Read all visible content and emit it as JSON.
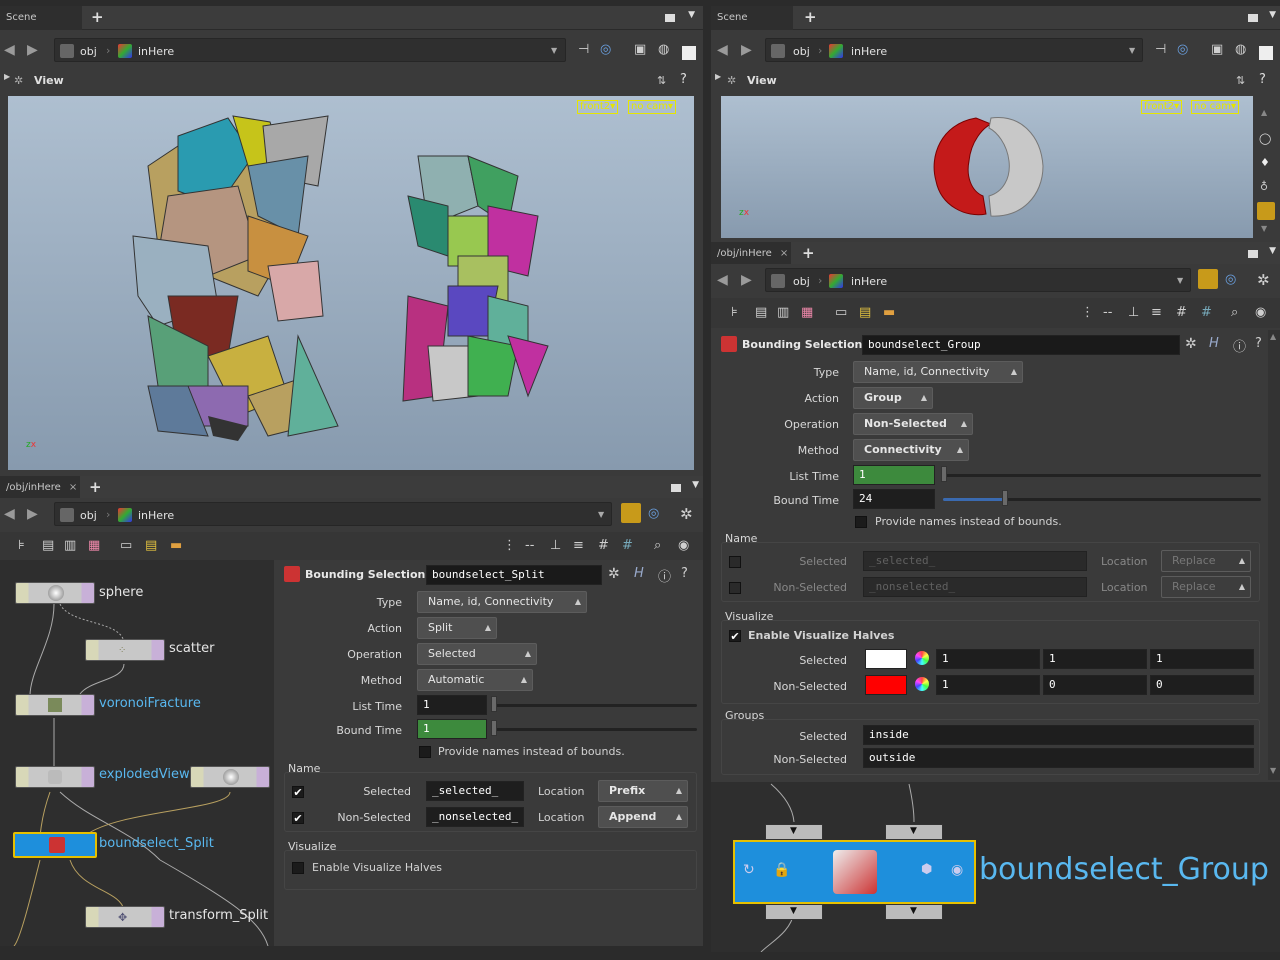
{
  "left_scene": {
    "tab": "Scene View",
    "path_obj": "obj",
    "path_node": "inHere",
    "view_label": "View",
    "cam_view": "front2",
    "cam_cam": "no cam"
  },
  "right_scene": {
    "tab": "Scene View",
    "path_obj": "obj",
    "path_node": "inHere",
    "view_label": "View",
    "cam_view": "front2",
    "cam_cam": "no cam"
  },
  "left_network": {
    "tab": "/obj/inHere",
    "path_obj": "obj",
    "path_node": "inHere",
    "nodes": [
      {
        "label": "sphere"
      },
      {
        "label": "scatter"
      },
      {
        "label": "voronoiFracture"
      },
      {
        "label": "explodedView"
      },
      {
        "label": "boundselect_Split"
      },
      {
        "label": "transform_Split"
      }
    ],
    "parms": {
      "title": "Bounding Selection",
      "node_name": "boundselect_Split",
      "type_label": "Type",
      "type_value": "Name, id, Connectivity",
      "action_label": "Action",
      "action_value": "Split",
      "operation_label": "Operation",
      "operation_value": "Selected",
      "method_label": "Method",
      "method_value": "Automatic",
      "list_time_label": "List Time",
      "list_time_value": "1",
      "bound_time_label": "Bound Time",
      "bound_time_value": "1",
      "provide_names": "Provide names instead of bounds.",
      "name_section": "Name",
      "selected_label": "Selected",
      "selected_value": "_selected_",
      "location_label": "Location",
      "selected_location": "Prefix",
      "nonselected_label": "Non-Selected",
      "nonselected_value": "_nonselected_",
      "nonselected_location": "Append",
      "visualize_section": "Visualize",
      "enable_visualize": "Enable Visualize Halves"
    }
  },
  "right_network": {
    "tab": "/obj/inHere",
    "path_obj": "obj",
    "path_node": "inHere",
    "node_label": "boundselect_Group",
    "parms": {
      "title": "Bounding Selection",
      "node_name": "boundselect_Group",
      "type_label": "Type",
      "type_value": "Name, id, Connectivity",
      "action_label": "Action",
      "action_value": "Group",
      "operation_label": "Operation",
      "operation_value": "Non-Selected",
      "method_label": "Method",
      "method_value": "Connectivity",
      "list_time_label": "List Time",
      "list_time_value": "1",
      "bound_time_label": "Bound Time",
      "bound_time_value": "24",
      "provide_names": "Provide names instead of bounds.",
      "name_section": "Name",
      "selected_label": "Selected",
      "selected_value": "_selected_",
      "location_label": "Location",
      "selected_location": "Replace",
      "nonselected_label": "Non-Selected",
      "nonselected_value": "_nonselected_",
      "nonselected_location": "Replace",
      "visualize_section": "Visualize",
      "enable_visualize": "Enable Visualize Halves",
      "vis_selected_label": "Selected",
      "vis_selected_color": "#ffffff",
      "vis_selected_rgb": [
        "1",
        "1",
        "1"
      ],
      "vis_nonselected_label": "Non-Selected",
      "vis_nonselected_color": "#ff0000",
      "vis_nonselected_rgb": [
        "1",
        "0",
        "0"
      ],
      "groups_section": "Groups",
      "groups_selected_label": "Selected",
      "groups_selected_value": "inside",
      "groups_nonselected_label": "Non-Selected",
      "groups_nonselected_value": "outside"
    }
  },
  "colors": {
    "accent_yellow": "#e6e600",
    "node_selected_blue": "#1e8fdc",
    "node_label_blue": "#59b8f0",
    "green_field": "#3d8a3d"
  }
}
